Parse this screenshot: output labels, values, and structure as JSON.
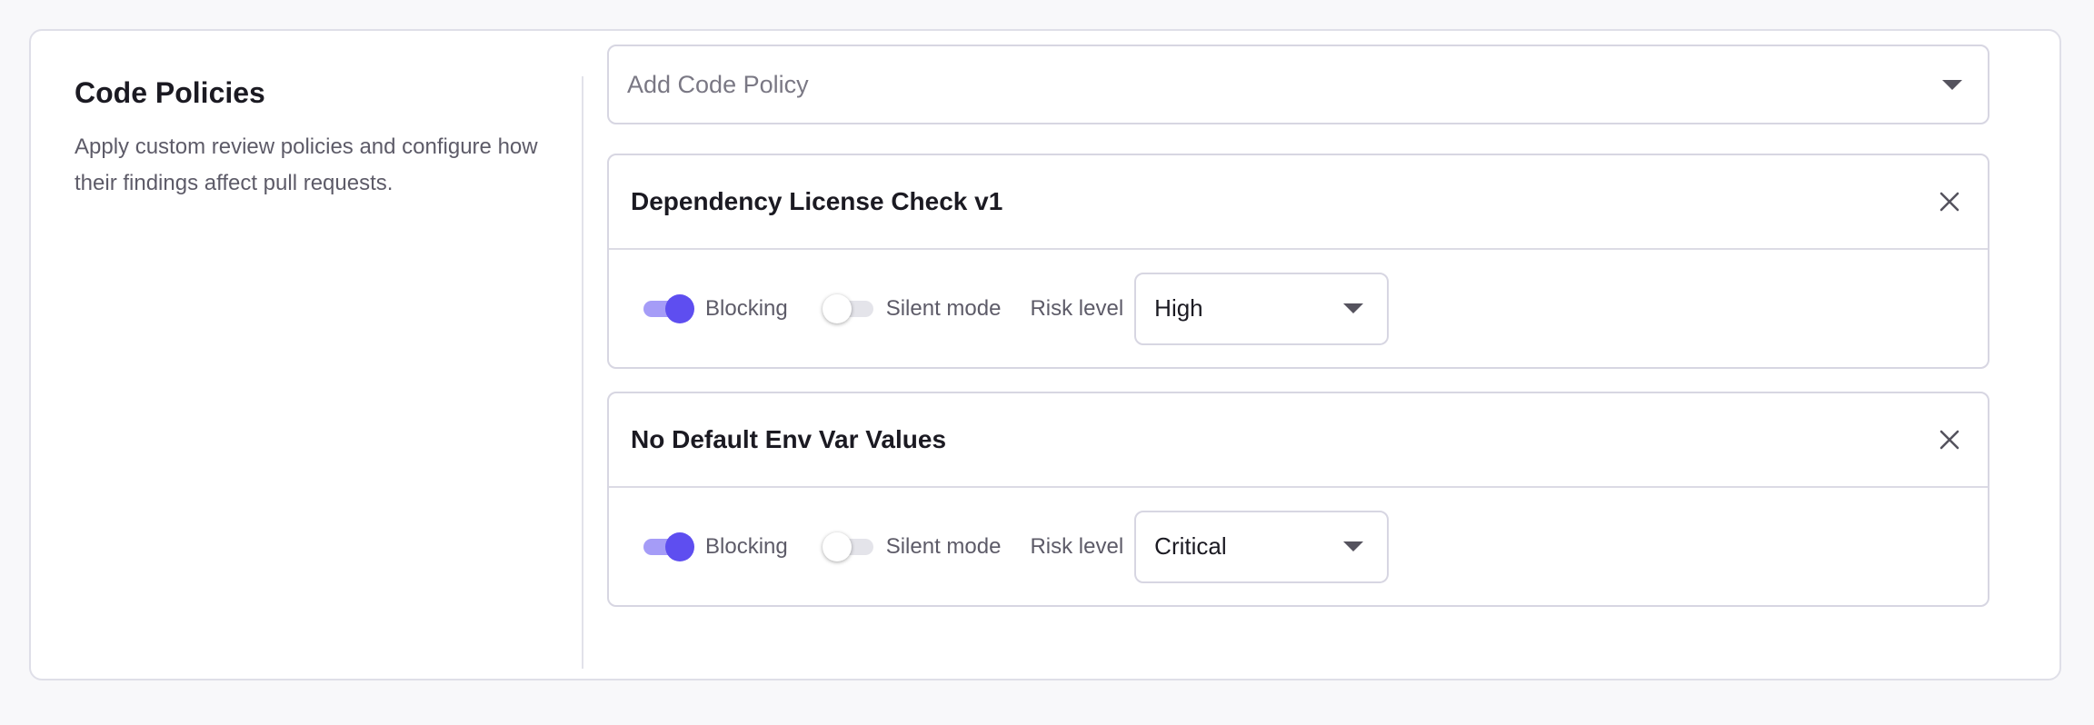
{
  "section": {
    "title": "Code Policies",
    "description": "Apply custom review policies and configure how their findings affect pull requests."
  },
  "add_policy": {
    "placeholder": "Add Code Policy",
    "icon": "chevron-down-icon"
  },
  "policies": [
    {
      "name": "Dependency License Check v1",
      "blocking_label": "Blocking",
      "blocking_on": true,
      "silent_label": "Silent mode",
      "silent_on": false,
      "risk_label": "Risk level",
      "risk_value": "High",
      "close_icon": "close-icon"
    },
    {
      "name": "No Default Env Var Values",
      "blocking_label": "Blocking",
      "blocking_on": true,
      "silent_label": "Silent mode",
      "silent_on": false,
      "risk_label": "Risk level",
      "risk_value": "Critical",
      "close_icon": "close-icon"
    }
  ],
  "colors": {
    "accent": "#5e4ef0",
    "accent_track": "#a59cf7",
    "border": "#d7d6e2"
  }
}
